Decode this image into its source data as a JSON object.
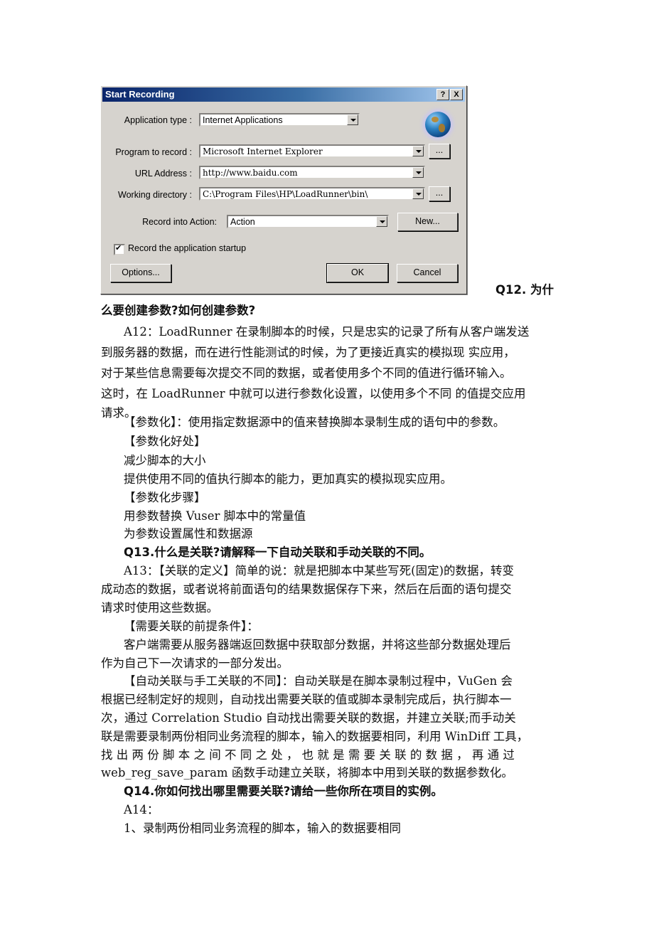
{
  "dialog": {
    "title": "Start Recording",
    "help_label": "?",
    "close_label": "X",
    "application_type": {
      "label": "Application type :",
      "value": "Internet Applications"
    },
    "program_to_record": {
      "label": "Program to record :",
      "value": "Microsoft Internet Explorer"
    },
    "url_address": {
      "label": "URL Address :",
      "value": "http://www.baidu.com"
    },
    "working_directory": {
      "label": "Working directory :",
      "value": "C:\\Program Files\\HP\\LoadRunner\\bin\\"
    },
    "record_into_action": {
      "label": "Record into Action:",
      "value": "Action"
    },
    "browse_label": "...",
    "new_label": "New...",
    "record_startup": {
      "label": "Record the application startup",
      "checked": true
    },
    "options_label": "Options...",
    "ok_label": "OK",
    "cancel_label": "Cancel"
  },
  "document": {
    "q12_head": "Q12. 为什",
    "lines": [
      "么要创建参数?如何创建参数?",
      "A12：LoadRunner 在录制脚本的时候，只是忠实的记录了所有从客户端发送",
      "到服务器的数据，而在进行性能测试的时候，为了更接近真实的模拟现 实应用，",
      "对于某些信息需要每次提交不同的数据，或者使用多个不同的值进行循环输入。",
      "这时，在 LoadRunner 中就可以进行参数化设置，以使用多个不同 的值提交应用",
      "请求。",
      "【参数化】：使用指定数据源中的值来替换脚本录制生成的语句中的参数。",
      "【参数化好处】",
      "减少脚本的大小",
      "提供使用不同的值执行脚本的能力，更加真实的模拟现实应用。",
      "【参数化步骤】",
      "用参数替换 Vuser 脚本中的常量值",
      "为参数设置属性和数据源",
      "Q13.什么是关联?请解释一下自动关联和手动关联的不同。",
      "A13：【关联的定义】简单的说：就是把脚本中某些写死(固定)的数据，转变",
      "成动态的数据，或者说将前面语句的结果数据保存下来，然后在后面的语句提交",
      "请求时使用这些数据。",
      "【需要关联的前提条件】：",
      "客户端需要从服务器端返回数据中获取部分数据，并将这些部分数据处理后",
      "作为自己下一次请求的一部分发出。",
      "【自动关联与手工关联的不同】：自动关联是在脚本录制过程中，VuGen 会",
      "根据已经制定好的规则，自动找出需要关联的值或脚本录制完成后，执行脚本一",
      "次，通过 Correlation Studio 自动找出需要关联的数据，并建立关联;而手动关",
      "联是需要录制两份相同业务流程的脚本，输入的数据要相同，利用 WinDiff 工具，",
      "找 出 两 份 脚   本 之 间 不 同 之 处 ， 也 就 是 需 要 关 联 的 数 据 ， 再 通 过",
      "web_reg_save_param 函数手动建立关联，将脚本中用到关联的数据参数化。",
      "Q14.你如何找出哪里需要关联?请给一些你所在项目的实例。",
      "A14：",
      "1、录制两份相同业务流程的脚本，输入的数据要相同"
    ]
  }
}
